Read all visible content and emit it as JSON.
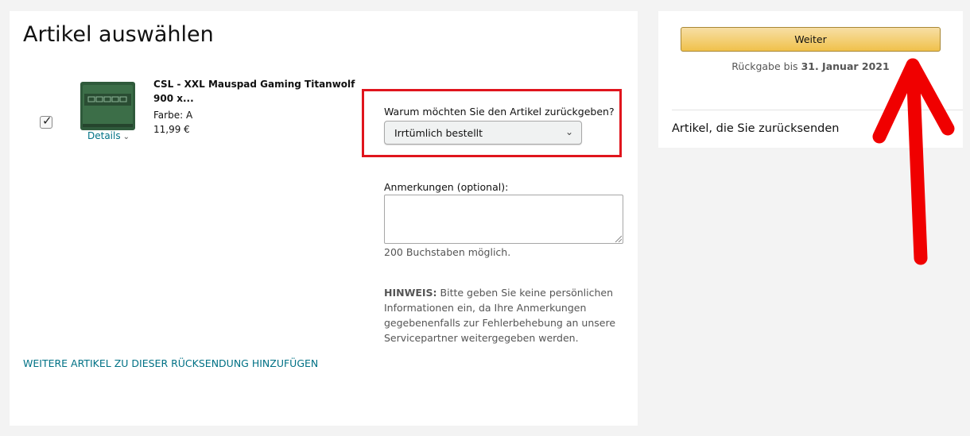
{
  "main": {
    "title": "Artikel auswählen",
    "item": {
      "checked": true,
      "title": "CSL - XXL Mauspad Gaming Titanwolf 900 x...",
      "color_line": "Farbe: A",
      "price": "11,99 €",
      "details_label": "Details"
    },
    "reason": {
      "label": "Warum möchten Sie den Artikel zurückgeben?",
      "selected": "Irrtümlich bestellt"
    },
    "notes": {
      "label": "Anmerkungen (optional):",
      "hint": "200 Buchstaben möglich."
    },
    "notice": {
      "prefix": "HINWEIS:",
      "text": "Bitte geben Sie keine persönlichen Informationen ein, da Ihre Anmerkungen gegebenenfalls zur Fehlerbehebung an unsere Servicepartner weitergegeben werden."
    },
    "add_more_link": "WEITERE ARTIKEL ZU DIESER RÜCKSENDUNG HINZUFÜGEN"
  },
  "side": {
    "continue_label": "Weiter",
    "deadline_prefix": "Rückgabe bis",
    "deadline_date": "31. Januar 2021",
    "items_heading": "Artikel, die Sie zurücksenden"
  },
  "colors": {
    "link": "#007185",
    "highlight_box": "#e0151d",
    "annotation_arrow": "#f00000",
    "button": "#f0c14b"
  },
  "icons": {
    "checkbox": "check-icon",
    "chevron": "chevron-down-icon",
    "annotation": "red-arrow-up-icon"
  }
}
